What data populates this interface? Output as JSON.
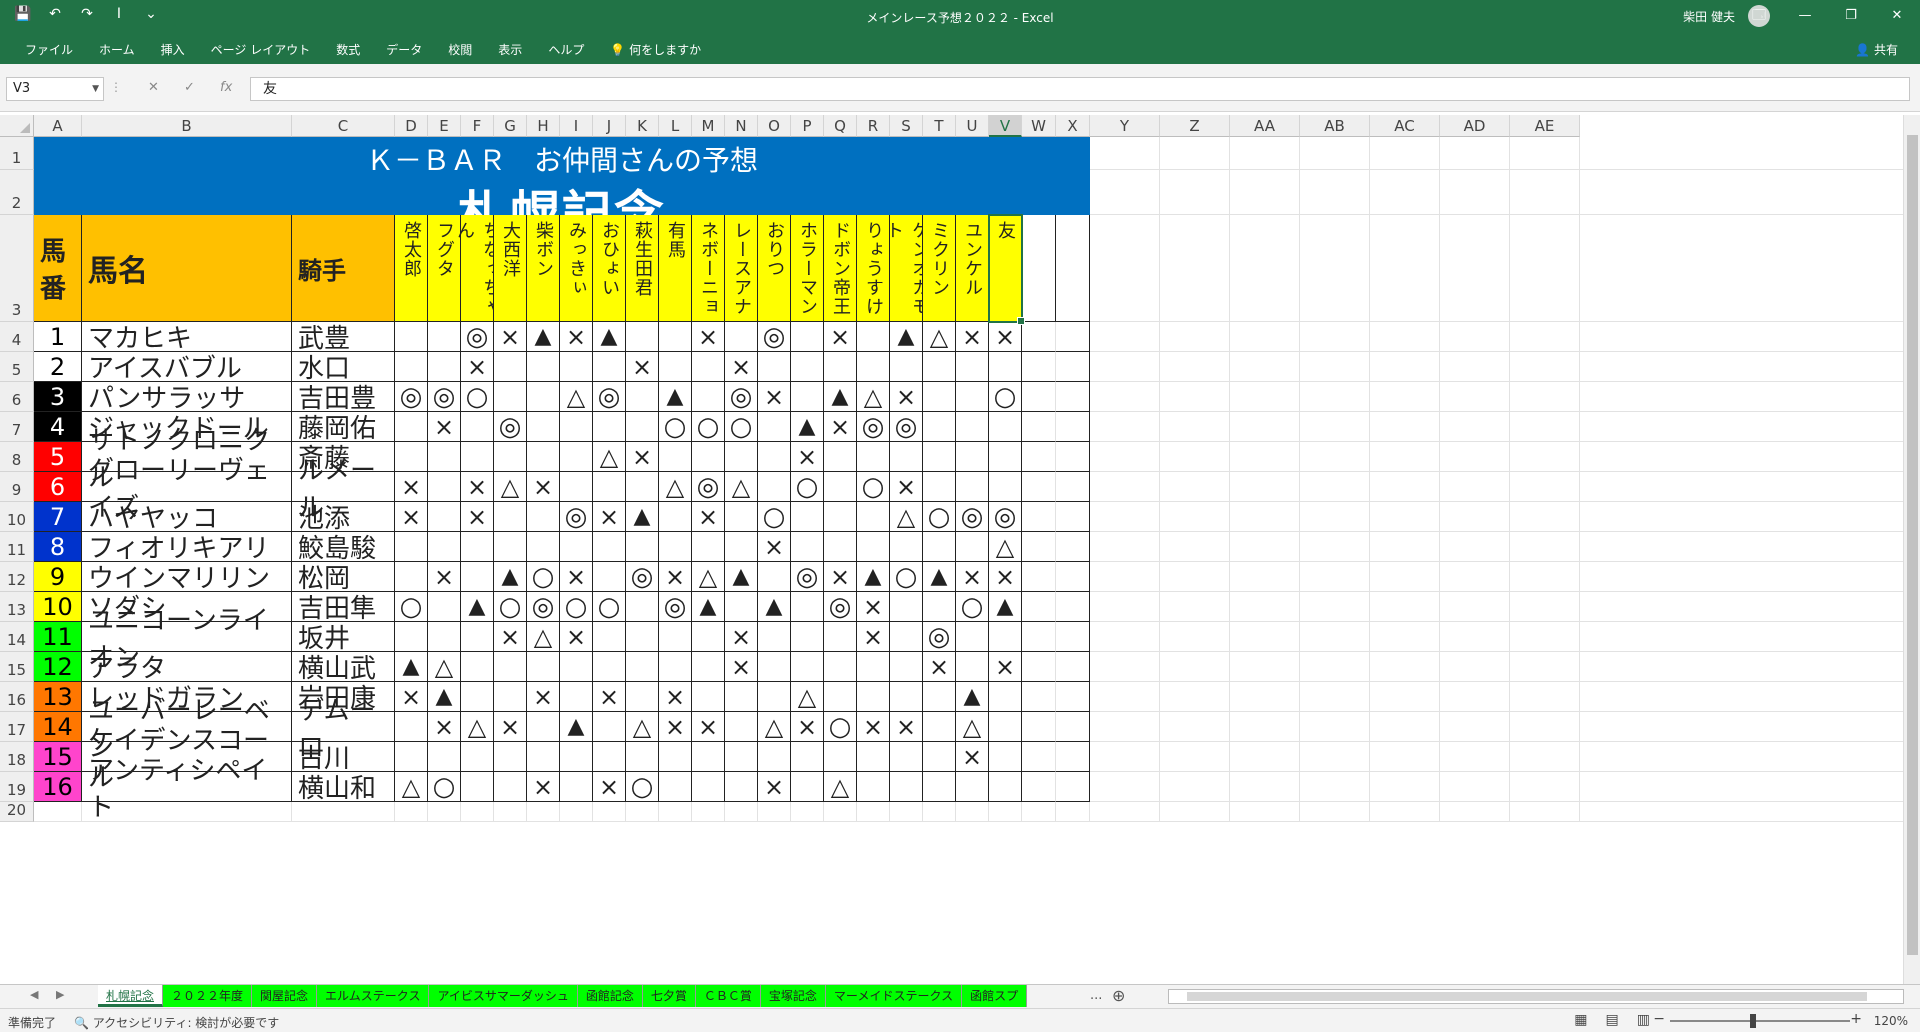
{
  "window": {
    "title": "メインレース予想２０２２ - Excel",
    "user": "柴田 健夫",
    "controls": [
      "🗔",
      "—",
      "❐",
      "✕"
    ]
  },
  "qat": [
    "💾",
    "↶",
    "↷",
    "I",
    "⌄"
  ],
  "ribbon": {
    "tabs": [
      "ファイル",
      "ホーム",
      "挿入",
      "ページ レイアウト",
      "数式",
      "データ",
      "校閲",
      "表示",
      "ヘルプ",
      "💡 何をしますか"
    ],
    "share": "共有"
  },
  "formula_bar": {
    "name_box": "V3",
    "cancel_glyph": "✕",
    "enter_glyph": "✓",
    "fx_glyph": "fx",
    "content": "友"
  },
  "columns": [
    "A",
    "B",
    "C",
    "D",
    "E",
    "F",
    "G",
    "H",
    "I",
    "J",
    "K",
    "L",
    "M",
    "N",
    "O",
    "P",
    "Q",
    "R",
    "S",
    "T",
    "U",
    "V",
    "W",
    "X",
    "Y",
    "Z",
    "AA",
    "AB",
    "AC",
    "AD",
    "AE"
  ],
  "selected_column": "V",
  "rows": [
    "1",
    "2",
    "3",
    "4",
    "5",
    "6",
    "7",
    "8",
    "9",
    "10",
    "11",
    "12",
    "13",
    "14",
    "15",
    "16",
    "17",
    "18",
    "19",
    "20"
  ],
  "sheet": {
    "banner_line1": "Ｋ－ＢＡＲ　お仲間さんの予想",
    "banner_line2": "札幌記念",
    "header": {
      "umaban": "馬番",
      "bamei": "馬名",
      "kishu": "騎手"
    },
    "predictors": [
      "啓太郎",
      "フグタ",
      "ちなっちゃん",
      "大西洋",
      "柴ボン",
      "みっきぃ",
      "おひょい",
      "萩生田君",
      "有馬",
      "ネボーニョ",
      "レースアナ",
      "おりつ",
      "ホラーマン",
      "ドボン帝王",
      "りょうすけ",
      "ケンオカモト",
      "ミクリン",
      "ユンケル",
      "友"
    ],
    "horses": [
      {
        "no": "1",
        "name": "マカヒキ",
        "jockey": "武豊",
        "bg": "#ffffff",
        "fg": "#000000",
        "marks": [
          "",
          "",
          "◎",
          "×",
          "▲",
          "×",
          "▲",
          "",
          "",
          "×",
          "",
          "◎",
          "",
          "×",
          "",
          "▲",
          "△",
          "×",
          "×"
        ]
      },
      {
        "no": "2",
        "name": "アイスバブル",
        "jockey": "水口",
        "bg": "#ffffff",
        "fg": "#000000",
        "marks": [
          "",
          "",
          "×",
          "",
          "",
          "",
          "",
          "×",
          "",
          "",
          "×",
          "",
          "",
          "",
          "",
          "",
          "",
          "",
          ""
        ]
      },
      {
        "no": "3",
        "name": "パンサラッサ",
        "jockey": "吉田豊",
        "bg": "#000000",
        "fg": "#ffffff",
        "marks": [
          "◎",
          "◎",
          "○",
          "",
          "",
          "△",
          "◎",
          "",
          "▲",
          "",
          "◎",
          "×",
          "",
          "▲",
          "△",
          "×",
          "",
          "",
          "○"
        ]
      },
      {
        "no": "4",
        "name": "ジャックドール",
        "jockey": "藤岡佑",
        "bg": "#000000",
        "fg": "#ffffff",
        "marks": [
          "",
          "×",
          "",
          "◎",
          "",
          "",
          "",
          "",
          "○",
          "○",
          "○",
          "",
          "▲",
          "×",
          "◎",
          "◎",
          "",
          "",
          ""
        ]
      },
      {
        "no": "5",
        "name": "サトノクロニクル",
        "jockey": "斎藤",
        "bg": "#ff0000",
        "fg": "#ffffff",
        "marks": [
          "",
          "",
          "",
          "",
          "",
          "",
          "△",
          "×",
          "",
          "",
          "",
          "",
          "×",
          "",
          "",
          "",
          "",
          "",
          ""
        ]
      },
      {
        "no": "6",
        "name": "グローリーヴェイズ",
        "jockey": "ルメール",
        "bg": "#ff0000",
        "fg": "#ffffff",
        "marks": [
          "×",
          "",
          "×",
          "△",
          "×",
          "",
          "",
          "",
          "△",
          "◎",
          "△",
          "",
          "○",
          "",
          "○",
          "×",
          "",
          "",
          ""
        ]
      },
      {
        "no": "7",
        "name": "ハヤヤッコ",
        "jockey": "池添",
        "bg": "#0033cc",
        "fg": "#ffffff",
        "marks": [
          "×",
          "",
          "×",
          "",
          "",
          "◎",
          "×",
          "▲",
          "",
          "×",
          "",
          "○",
          "",
          "",
          "",
          "△",
          "○",
          "◎",
          "◎"
        ]
      },
      {
        "no": "8",
        "name": "フィオリキアリ",
        "jockey": "鮫島駿",
        "bg": "#0033cc",
        "fg": "#ffffff",
        "marks": [
          "",
          "",
          "",
          "",
          "",
          "",
          "",
          "",
          "",
          "",
          "",
          "×",
          "",
          "",
          "",
          "",
          "",
          "",
          "△"
        ]
      },
      {
        "no": "9",
        "name": "ウインマリリン",
        "jockey": "松岡",
        "bg": "#ffff00",
        "fg": "#000000",
        "marks": [
          "",
          "×",
          "",
          "▲",
          "○",
          "×",
          "",
          "◎",
          "×",
          "△",
          "▲",
          "",
          "◎",
          "×",
          "▲",
          "○",
          "▲",
          "×",
          "×"
        ]
      },
      {
        "no": "10",
        "name": "ソダシ",
        "jockey": "吉田隼",
        "bg": "#ffff00",
        "fg": "#000000",
        "marks": [
          "○",
          "",
          "▲",
          "○",
          "◎",
          "○",
          "○",
          "",
          "◎",
          "▲",
          "",
          "▲",
          "",
          "◎",
          "×",
          "",
          "",
          "○",
          "▲"
        ]
      },
      {
        "no": "11",
        "name": "ユニコーンライオン",
        "jockey": "坂井",
        "bg": "#00ff00",
        "fg": "#000000",
        "marks": [
          "",
          "",
          "",
          "×",
          "△",
          "×",
          "",
          "",
          "",
          "",
          "×",
          "",
          "",
          "",
          "×",
          "",
          "◎",
          "",
          ""
        ]
      },
      {
        "no": "12",
        "name": "アラタ",
        "jockey": "横山武",
        "bg": "#00ff00",
        "fg": "#000000",
        "marks": [
          "▲",
          "△",
          "",
          "",
          "",
          "",
          "",
          "",
          "",
          "",
          "×",
          "",
          "",
          "",
          "",
          "",
          "×",
          "",
          "×"
        ]
      },
      {
        "no": "13",
        "name": "レッドガラン",
        "jockey": "岩田康",
        "bg": "#ff7700",
        "fg": "#000000",
        "marks": [
          "×",
          "▲",
          "",
          "",
          "×",
          "",
          "×",
          "",
          "×",
          "",
          "",
          "",
          "△",
          "",
          "",
          "",
          "",
          "▲",
          ""
        ]
      },
      {
        "no": "14",
        "name": "ユーバーレーベン",
        "jockey": "デムーロ",
        "bg": "#ff7700",
        "fg": "#000000",
        "marks": [
          "",
          "×",
          "△",
          "×",
          "",
          "▲",
          "",
          "△",
          "×",
          "×",
          "",
          "△",
          "×",
          "○",
          "×",
          "×",
          "",
          "△",
          ""
        ]
      },
      {
        "no": "15",
        "name": "ケイデンスコール",
        "jockey": "古川",
        "bg": "#ff44cc",
        "fg": "#000000",
        "marks": [
          "",
          "",
          "",
          "",
          "",
          "",
          "",
          "",
          "",
          "",
          "",
          "",
          "",
          "",
          "",
          "",
          "",
          "×",
          ""
        ]
      },
      {
        "no": "16",
        "name": "アンティシペイト",
        "jockey": "横山和",
        "bg": "#ff44cc",
        "fg": "#000000",
        "marks": [
          "△",
          "○",
          "",
          "",
          "×",
          "",
          "×",
          "○",
          "",
          "",
          "",
          "×",
          "",
          "△",
          "",
          "",
          "",
          "",
          ""
        ]
      }
    ]
  },
  "sheet_tabs": [
    "札幌記念",
    "２０２２年度",
    "関屋記念",
    "エルムステークス",
    "アイビスサマーダッシュ",
    "函館記念",
    "七夕賞",
    "ＣＢＣ賞",
    "宝塚記念",
    "マーメイドステークス",
    "函館スプ"
  ],
  "active_sheet": "札幌記念",
  "sheet_nav": {
    "prev": "◀",
    "next": "▶",
    "more": "...",
    "add": "⊕"
  },
  "status": {
    "ready": "準備完了",
    "accessibility": "アクセシビリティ: 検討が必要です",
    "view_icons": [
      "▦",
      "▤",
      "▥"
    ],
    "zoom_minus": "−",
    "zoom_plus": "+",
    "zoom": "120%",
    "zoom_fraction": 0.6
  },
  "colors": {
    "excel_green": "#217346",
    "banner_blue": "#0070c0",
    "header_orange": "#ffc000",
    "header_yellow": "#ffff00",
    "sheet_tab_green": "#00ff00"
  }
}
